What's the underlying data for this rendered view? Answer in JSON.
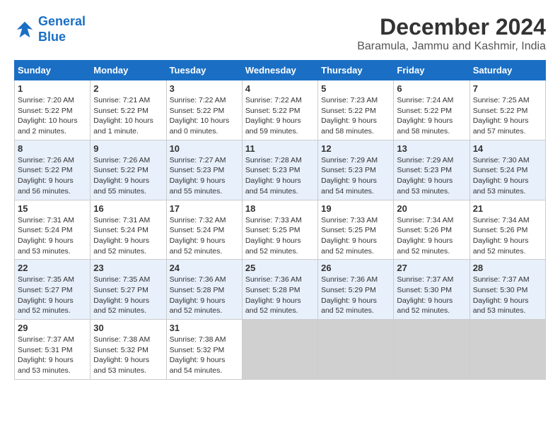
{
  "logo": {
    "line1": "General",
    "line2": "Blue"
  },
  "title": "December 2024",
  "subtitle": "Baramula, Jammu and Kashmir, India",
  "days_of_week": [
    "Sunday",
    "Monday",
    "Tuesday",
    "Wednesday",
    "Thursday",
    "Friday",
    "Saturday"
  ],
  "weeks": [
    [
      {
        "day": "1",
        "info": "Sunrise: 7:20 AM\nSunset: 5:22 PM\nDaylight: 10 hours\nand 2 minutes."
      },
      {
        "day": "2",
        "info": "Sunrise: 7:21 AM\nSunset: 5:22 PM\nDaylight: 10 hours\nand 1 minute."
      },
      {
        "day": "3",
        "info": "Sunrise: 7:22 AM\nSunset: 5:22 PM\nDaylight: 10 hours\nand 0 minutes."
      },
      {
        "day": "4",
        "info": "Sunrise: 7:22 AM\nSunset: 5:22 PM\nDaylight: 9 hours\nand 59 minutes."
      },
      {
        "day": "5",
        "info": "Sunrise: 7:23 AM\nSunset: 5:22 PM\nDaylight: 9 hours\nand 58 minutes."
      },
      {
        "day": "6",
        "info": "Sunrise: 7:24 AM\nSunset: 5:22 PM\nDaylight: 9 hours\nand 58 minutes."
      },
      {
        "day": "7",
        "info": "Sunrise: 7:25 AM\nSunset: 5:22 PM\nDaylight: 9 hours\nand 57 minutes."
      }
    ],
    [
      {
        "day": "8",
        "info": "Sunrise: 7:26 AM\nSunset: 5:22 PM\nDaylight: 9 hours\nand 56 minutes."
      },
      {
        "day": "9",
        "info": "Sunrise: 7:26 AM\nSunset: 5:22 PM\nDaylight: 9 hours\nand 55 minutes."
      },
      {
        "day": "10",
        "info": "Sunrise: 7:27 AM\nSunset: 5:23 PM\nDaylight: 9 hours\nand 55 minutes."
      },
      {
        "day": "11",
        "info": "Sunrise: 7:28 AM\nSunset: 5:23 PM\nDaylight: 9 hours\nand 54 minutes."
      },
      {
        "day": "12",
        "info": "Sunrise: 7:29 AM\nSunset: 5:23 PM\nDaylight: 9 hours\nand 54 minutes."
      },
      {
        "day": "13",
        "info": "Sunrise: 7:29 AM\nSunset: 5:23 PM\nDaylight: 9 hours\nand 53 minutes."
      },
      {
        "day": "14",
        "info": "Sunrise: 7:30 AM\nSunset: 5:24 PM\nDaylight: 9 hours\nand 53 minutes."
      }
    ],
    [
      {
        "day": "15",
        "info": "Sunrise: 7:31 AM\nSunset: 5:24 PM\nDaylight: 9 hours\nand 53 minutes."
      },
      {
        "day": "16",
        "info": "Sunrise: 7:31 AM\nSunset: 5:24 PM\nDaylight: 9 hours\nand 52 minutes."
      },
      {
        "day": "17",
        "info": "Sunrise: 7:32 AM\nSunset: 5:24 PM\nDaylight: 9 hours\nand 52 minutes."
      },
      {
        "day": "18",
        "info": "Sunrise: 7:33 AM\nSunset: 5:25 PM\nDaylight: 9 hours\nand 52 minutes."
      },
      {
        "day": "19",
        "info": "Sunrise: 7:33 AM\nSunset: 5:25 PM\nDaylight: 9 hours\nand 52 minutes."
      },
      {
        "day": "20",
        "info": "Sunrise: 7:34 AM\nSunset: 5:26 PM\nDaylight: 9 hours\nand 52 minutes."
      },
      {
        "day": "21",
        "info": "Sunrise: 7:34 AM\nSunset: 5:26 PM\nDaylight: 9 hours\nand 52 minutes."
      }
    ],
    [
      {
        "day": "22",
        "info": "Sunrise: 7:35 AM\nSunset: 5:27 PM\nDaylight: 9 hours\nand 52 minutes."
      },
      {
        "day": "23",
        "info": "Sunrise: 7:35 AM\nSunset: 5:27 PM\nDaylight: 9 hours\nand 52 minutes."
      },
      {
        "day": "24",
        "info": "Sunrise: 7:36 AM\nSunset: 5:28 PM\nDaylight: 9 hours\nand 52 minutes."
      },
      {
        "day": "25",
        "info": "Sunrise: 7:36 AM\nSunset: 5:28 PM\nDaylight: 9 hours\nand 52 minutes."
      },
      {
        "day": "26",
        "info": "Sunrise: 7:36 AM\nSunset: 5:29 PM\nDaylight: 9 hours\nand 52 minutes."
      },
      {
        "day": "27",
        "info": "Sunrise: 7:37 AM\nSunset: 5:30 PM\nDaylight: 9 hours\nand 52 minutes."
      },
      {
        "day": "28",
        "info": "Sunrise: 7:37 AM\nSunset: 5:30 PM\nDaylight: 9 hours\nand 53 minutes."
      }
    ],
    [
      {
        "day": "29",
        "info": "Sunrise: 7:37 AM\nSunset: 5:31 PM\nDaylight: 9 hours\nand 53 minutes."
      },
      {
        "day": "30",
        "info": "Sunrise: 7:38 AM\nSunset: 5:32 PM\nDaylight: 9 hours\nand 53 minutes."
      },
      {
        "day": "31",
        "info": "Sunrise: 7:38 AM\nSunset: 5:32 PM\nDaylight: 9 hours\nand 54 minutes."
      },
      {
        "day": "",
        "info": ""
      },
      {
        "day": "",
        "info": ""
      },
      {
        "day": "",
        "info": ""
      },
      {
        "day": "",
        "info": ""
      }
    ]
  ]
}
